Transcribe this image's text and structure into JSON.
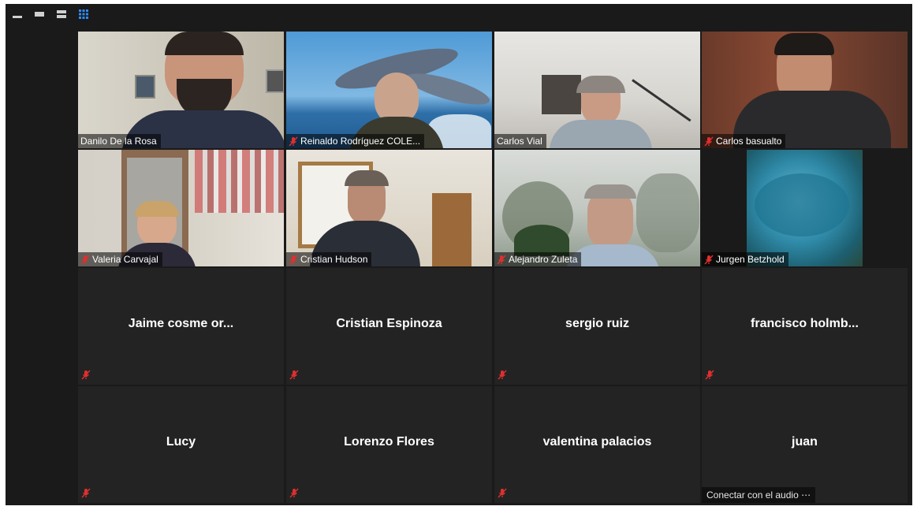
{
  "window": {
    "toolbar": [
      {
        "icon": "minimize-icon"
      },
      {
        "icon": "speaker-view-icon"
      },
      {
        "icon": "strip-view-icon"
      },
      {
        "icon": "gallery-view-icon",
        "color": "#2d8cff"
      }
    ]
  },
  "colors": {
    "background": "#1a1a1a",
    "tile": "#232323",
    "active_speaker_border": "#c9d94a",
    "mute_red": "#e02f2f"
  },
  "participants": [
    {
      "name": "Danilo De la Rosa",
      "video": true,
      "muted": false,
      "active_speaker": true
    },
    {
      "name": "Reinaldo Rodríguez  COLE...",
      "video": true,
      "muted": true
    },
    {
      "name": "Carlos Vial",
      "video": true,
      "muted": false
    },
    {
      "name": "Carlos basualto",
      "video": true,
      "muted": true
    },
    {
      "name": "Valeria Carvajal",
      "video": true,
      "muted": true
    },
    {
      "name": "Cristian Hudson",
      "video": true,
      "muted": true
    },
    {
      "name": "Alejandro Zuleta",
      "video": true,
      "muted": true
    },
    {
      "name": "Jurgen Betzhold",
      "video": true,
      "muted": true
    },
    {
      "name": "Jaime cosme or...",
      "video": false,
      "muted": true
    },
    {
      "name": "Cristian Espinoza",
      "video": false,
      "muted": true
    },
    {
      "name": "sergio ruiz",
      "video": false,
      "muted": true
    },
    {
      "name": "francisco  holmb...",
      "video": false,
      "muted": true
    },
    {
      "name": "Lucy",
      "video": false,
      "muted": true
    },
    {
      "name": "Lorenzo Flores",
      "video": false,
      "muted": true
    },
    {
      "name": "valentina palacios",
      "video": false,
      "muted": true
    },
    {
      "name": "juan",
      "video": false,
      "muted": false,
      "audio_prompt": "Conectar con el audio ⋯"
    }
  ]
}
